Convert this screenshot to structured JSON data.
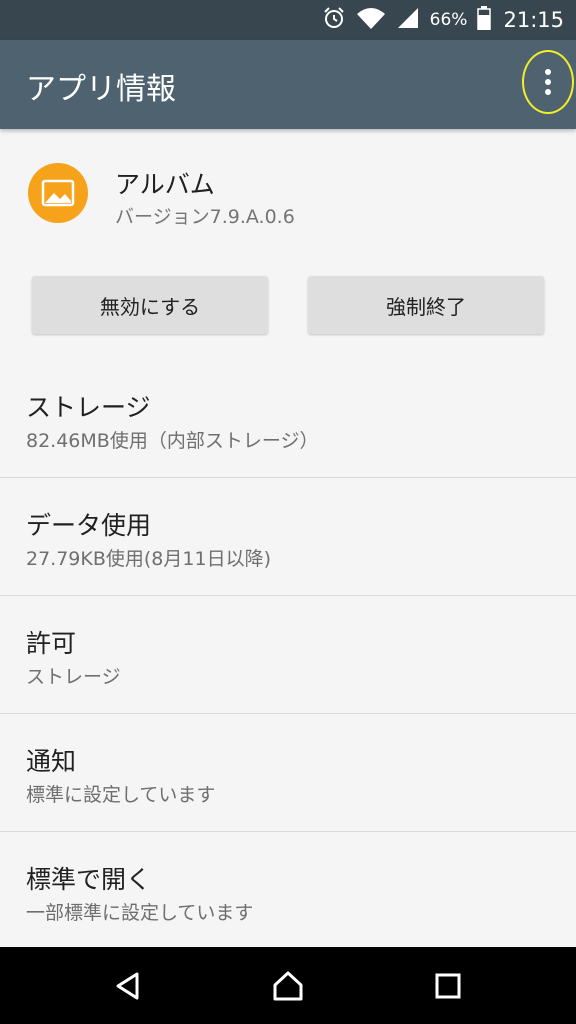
{
  "status_bar": {
    "battery_percent": "66%",
    "time": "21:15"
  },
  "app_bar": {
    "title": "アプリ情報"
  },
  "app": {
    "name": "アルバム",
    "version": "バージョン7.9.A.0.6"
  },
  "actions": {
    "disable_label": "無効にする",
    "force_stop_label": "強制終了"
  },
  "settings": [
    {
      "title": "ストレージ",
      "summary": "82.46MB使用（内部ストレージ）"
    },
    {
      "title": "データ使用",
      "summary": "27.79KB使用(8月11日以降)"
    },
    {
      "title": "許可",
      "summary": "ストレージ"
    },
    {
      "title": "通知",
      "summary": "標準に設定しています"
    },
    {
      "title": "標準で開く",
      "summary": "一部標準に設定しています"
    }
  ],
  "icons": {
    "status": [
      "alarm-icon",
      "wifi-icon",
      "cell-signal-icon",
      "battery-icon"
    ],
    "nav": [
      "back-icon",
      "home-icon",
      "recents-icon"
    ],
    "app": "gallery-icon",
    "menu": "more-vert-icon"
  },
  "colors": {
    "status_bar": "#38464f",
    "app_bar": "#4e6270",
    "app_icon": "#f6a21b",
    "overflow_highlight": "#f2ef2a",
    "button": "#dedede",
    "background": "#f5f5f5"
  }
}
